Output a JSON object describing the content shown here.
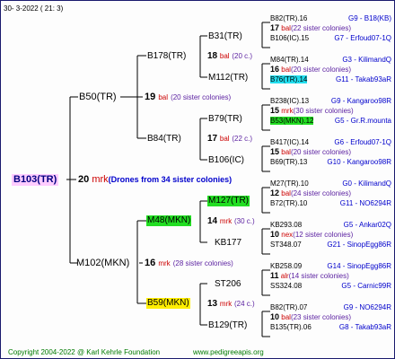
{
  "header": {
    "date": "30-   3-2022 ( 21:   3)"
  },
  "footer": {
    "copyright": "Copyright 2004-2022 @ Karl Kehrle Foundation",
    "site": "www.pedigreeapis.org"
  },
  "root": {
    "name": "B103(TR)",
    "num": "20",
    "abbr": "mrk",
    "note": "(Drones from 34 sister colonies)"
  },
  "gen1": [
    {
      "name": "B50(TR)",
      "num": "19",
      "abbr": "bal",
      "note": "(20 sister colonies)"
    },
    {
      "name": "M102(MKN)",
      "num": "16",
      "abbr": "mrk",
      "note": "(28 sister colonies)"
    }
  ],
  "gen2": [
    {
      "name": "B178(TR)",
      "num": "18",
      "abbr": "bal",
      "note": "(20 c.)"
    },
    {
      "name": "B84(TR)",
      "num": "17",
      "abbr": "bal",
      "note": "(22 c.)"
    },
    {
      "name": "M48(MKN)",
      "num": "14",
      "abbr": "mrk",
      "note": "(30 c.)"
    },
    {
      "name": "B59(MKN)",
      "num": "13",
      "abbr": "mrk",
      "note": "(24 c.)"
    }
  ],
  "gen3": [
    {
      "name": "B31(TR)"
    },
    {
      "name": "M112(TR)"
    },
    {
      "name": "B79(TR)"
    },
    {
      "name": "B106(IC)"
    },
    {
      "name": "M127(TR)"
    },
    {
      "name": "KB177"
    },
    {
      "name": "ST206"
    },
    {
      "name": "B129(TR)"
    }
  ],
  "gen4": [
    {
      "top": "B82(TR).16",
      "top_right": "G9 - B18(KB)",
      "num": "17",
      "abbr": "bal",
      "note": "(22 sister colonies)",
      "bottom": "B106(IC).15",
      "bottom_right": "G7 - Erfoud07-1Q"
    },
    {
      "top": "M84(TR).14",
      "top_right": "G3 - KilimandQ",
      "num": "16",
      "abbr": "bal",
      "note": "(20 sister colonies)",
      "bottom": "B76(TR).14",
      "bottom_right": "G11 - Takab93aR"
    },
    {
      "top": "B238(IC).13",
      "top_right": "G9 - Kangaroo98R",
      "num": "15",
      "abbr": "mrk",
      "note": "(30 sister colonies)",
      "bottom": "B53(MKN).12",
      "bottom_right": "G5 - Gr.R.mounta"
    },
    {
      "top": "B417(IC).14",
      "top_right": "G6 - Erfoud07-1Q",
      "num": "15",
      "abbr": "bal",
      "note": "(20 sister colonies)",
      "bottom": "B69(TR).13",
      "bottom_right": "G10 - Kangaroo98R"
    },
    {
      "top": "M27(TR).10",
      "top_right": "G0 - KilimandQ",
      "num": "12",
      "abbr": "bal",
      "note": "(24 sister colonies)",
      "bottom": "B72(TR).10",
      "bottom_right": "G11 - NO6294R"
    },
    {
      "top": "KB293.08",
      "top_right": "G5 - Ankar02Q",
      "num": "10",
      "abbr": "nex",
      "note": "(12 sister colonies)",
      "bottom": "ST348.07",
      "bottom_right": "G21 - SinopEgg86R"
    },
    {
      "top": "KB258.09",
      "top_right": "G14 - SinopEgg86R",
      "num": "11",
      "abbr": "alr",
      "note": "(14 sister colonies)",
      "bottom": "SS324.08",
      "bottom_right": "G5 - Carnic99R"
    },
    {
      "top": "B82(TR).07",
      "top_right": "G9 - NO6294R",
      "num": "10",
      "abbr": "bal",
      "note": "(23 sister colonies)",
      "bottom": "B135(TR).06",
      "bottom_right": "G8 - Takab93aR"
    }
  ],
  "colors": {
    "green_highlight": "#22dd22",
    "yellow_highlight": "#ffee00",
    "cyan_highlight": "#22ddee",
    "pink_highlight": "#ffccff",
    "blue": "#0000cc",
    "red": "#cc0000",
    "footer_green": "#007a00"
  }
}
